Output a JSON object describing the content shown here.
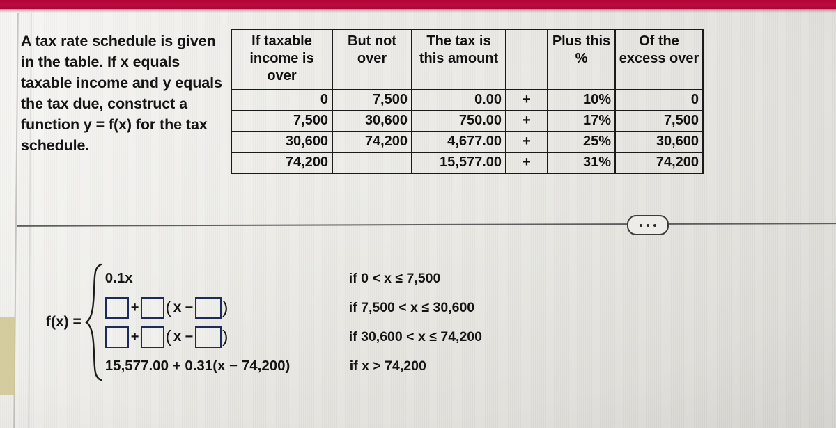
{
  "theme": {
    "accent_crimson": "#bc0a3d",
    "page_background": "#e9e8e4",
    "answer_box_border": "#1d2a5c",
    "text_color": "#141414"
  },
  "question": {
    "text": "A tax rate schedule is given in the table. If x equals taxable income and y equals the tax due, construct a function y = f(x) for the tax schedule."
  },
  "tax_table": {
    "headers": [
      "If taxable income is over",
      "But not over",
      "The tax is this amount",
      "",
      "Plus this %",
      "Of the excess over"
    ],
    "rows": [
      {
        "income_over": "0",
        "but_not_over": "7,500",
        "tax_amount": "0.00",
        "operator": "+",
        "percent": "10%",
        "excess_over": "0"
      },
      {
        "income_over": "7,500",
        "but_not_over": "30,600",
        "tax_amount": "750.00",
        "operator": "+",
        "percent": "17%",
        "excess_over": "7,500"
      },
      {
        "income_over": "30,600",
        "but_not_over": "74,200",
        "tax_amount": "4,677.00",
        "operator": "+",
        "percent": "25%",
        "excess_over": "30,600"
      },
      {
        "income_over": "74,200",
        "but_not_over": "",
        "tax_amount": "15,577.00",
        "operator": "+",
        "percent": "31%",
        "excess_over": "74,200"
      }
    ]
  },
  "toolbar": {
    "more_label": "...",
    "more_icon": "ellipsis-icon"
  },
  "answer": {
    "function_label": "f(x) =",
    "cases": [
      {
        "kind": "filled",
        "expression": "0.1x",
        "condition": "if 0 < x ≤ 7,500"
      },
      {
        "kind": "blanks",
        "box1_value": "",
        "box1_placeholder": "",
        "operator": "+",
        "box2_value": "",
        "box2_placeholder": "",
        "open_paren": "(",
        "variable": "x",
        "minus": "−",
        "box3_value": "",
        "box3_placeholder": "",
        "close_paren": ")",
        "condition": "if 7,500 < x ≤ 30,600"
      },
      {
        "kind": "blanks",
        "box1_value": "",
        "box1_placeholder": "",
        "operator": "+",
        "box2_value": "",
        "box2_placeholder": "",
        "open_paren": "(",
        "variable": "x",
        "minus": "−",
        "box3_value": "",
        "box3_placeholder": "",
        "close_paren": ")",
        "condition": "if 30,600 < x ≤ 74,200"
      },
      {
        "kind": "filled",
        "expression": "15,577.00 + 0.31(x − 74,200)",
        "condition": "if x > 74,200"
      }
    ]
  }
}
